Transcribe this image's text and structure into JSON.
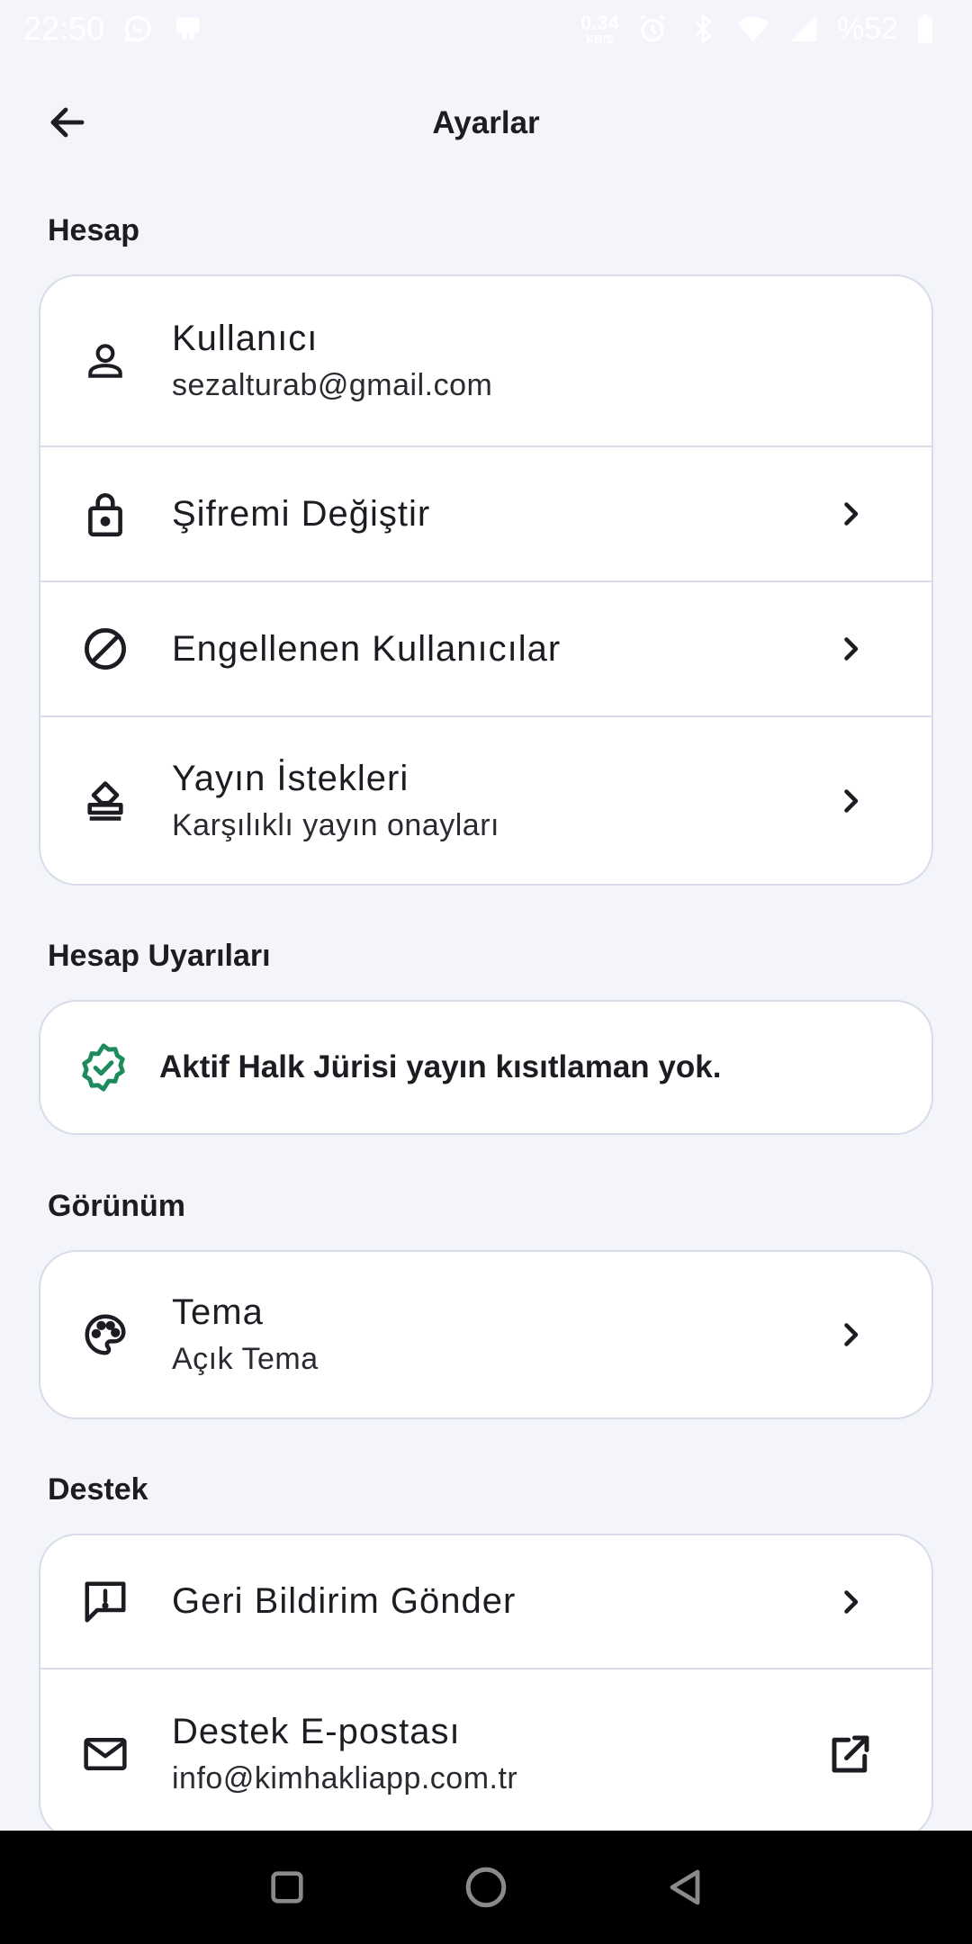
{
  "status_bar": {
    "time": "22:50",
    "net_speed_value": "0.34",
    "net_speed_unit": "KB/S",
    "battery_text": "%52",
    "icons": [
      "whatsapp-icon",
      "notification-icon",
      "alarm-icon",
      "bluetooth-icon",
      "wifi-icon",
      "signal-icon",
      "battery-icon"
    ]
  },
  "header": {
    "title": "Ayarlar",
    "back_icon": "arrow-left-icon"
  },
  "sections": {
    "account": {
      "title": "Hesap",
      "items": [
        {
          "icon": "user-icon",
          "title": "Kullanıcı",
          "subtitle": "sezalturab@gmail.com"
        },
        {
          "icon": "lock-icon",
          "title": "Şifremi Değiştir"
        },
        {
          "icon": "block-icon",
          "title": "Engellenen Kullanıcılar"
        },
        {
          "icon": "stamp-icon",
          "title": "Yayın İstekleri",
          "subtitle": "Karşılıklı yayın onayları"
        }
      ]
    },
    "alerts": {
      "title": "Hesap Uyarıları",
      "message": "Aktif Halk Jürisi yayın kısıtlaman yok.",
      "icon": "verified-badge-icon",
      "icon_color": "#1f8a5b"
    },
    "appearance": {
      "title": "Görünüm",
      "items": [
        {
          "icon": "palette-icon",
          "title": "Tema",
          "subtitle": "Açık Tema"
        }
      ]
    },
    "support": {
      "title": "Destek",
      "items": [
        {
          "icon": "feedback-icon",
          "title": "Geri Bildirim Gönder"
        },
        {
          "icon": "mail-icon",
          "title": "Destek E-postası",
          "subtitle": "info@kimhakliapp.com.tr",
          "trailing_icon": "open-external-icon"
        }
      ]
    }
  },
  "nav_bar": {
    "buttons": [
      "recents-icon",
      "home-icon",
      "back-triangle-icon"
    ]
  },
  "colors": {
    "background": "#f3f5fb",
    "card": "#ffffff",
    "border": "#d8dce8",
    "text": "#1c1d22",
    "accent_green": "#1f8a5b"
  }
}
